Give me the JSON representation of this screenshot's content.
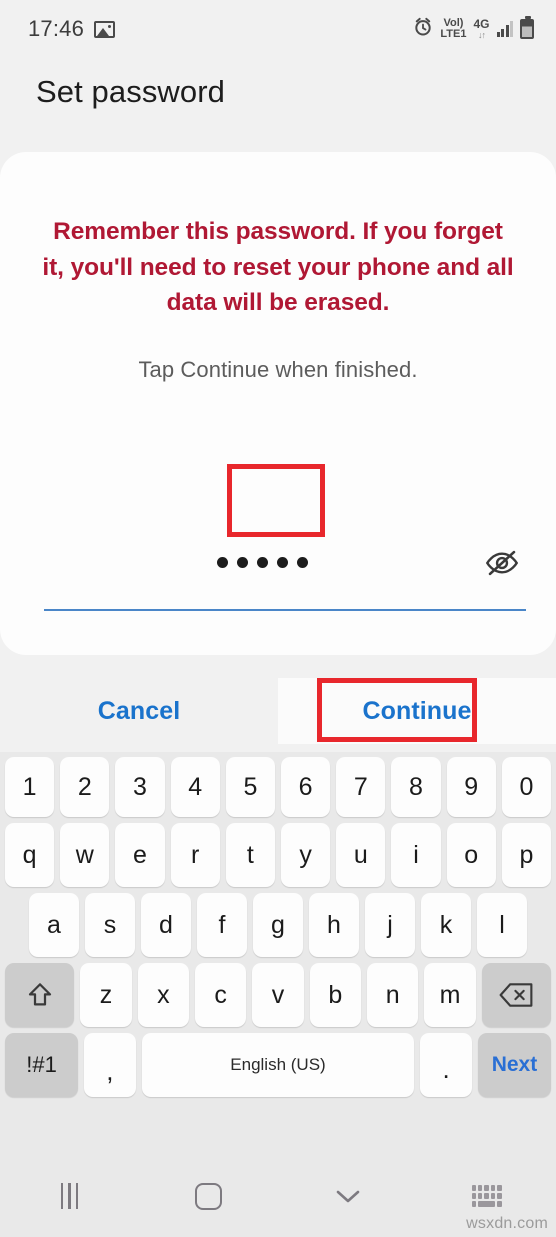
{
  "status_bar": {
    "time": "17:46",
    "icons": [
      "image-thumbnail-icon",
      "alarm-clock-icon",
      "volte-indicator",
      "network-4g",
      "signal-bars-icon",
      "battery-icon"
    ],
    "volte_top": "Vol)",
    "volte_bottom": "LTE1",
    "network": "4G",
    "network_arrows": "↓↑"
  },
  "header": {
    "title": "Set password"
  },
  "card": {
    "warning": "Remember this password. If you forget it, you'll need to reset your phone and all data will be erased.",
    "hint": "Tap Continue when finished.",
    "password_field": {
      "value": "•••••",
      "dot_count": 5,
      "toggle_icon": "eye-off-icon",
      "underline_color": "#4a86c8"
    }
  },
  "actions": {
    "cancel_label": "Cancel",
    "continue_label": "Continue",
    "accent_color": "#1a73cc"
  },
  "annotations": {
    "highlight_color": "#e8272c",
    "targets": [
      "password-field",
      "continue-button"
    ]
  },
  "keyboard": {
    "row_numbers": [
      "1",
      "2",
      "3",
      "4",
      "5",
      "6",
      "7",
      "8",
      "9",
      "0"
    ],
    "row_top": [
      "q",
      "w",
      "e",
      "r",
      "t",
      "y",
      "u",
      "i",
      "o",
      "p"
    ],
    "row_home": [
      "a",
      "s",
      "d",
      "f",
      "g",
      "h",
      "j",
      "k",
      "l"
    ],
    "row_bottom": [
      "z",
      "x",
      "c",
      "v",
      "b",
      "n",
      "m"
    ],
    "shift_key": "shift-icon",
    "backspace_key": "backspace-icon",
    "symbols_label": "!#1",
    "comma_label": ",",
    "space_label": "English (US)",
    "period_label": ".",
    "next_label": "Next"
  },
  "navbar": {
    "recents": "recents-icon",
    "home": "home-icon",
    "dismiss": "chevron-down-icon",
    "keyboard_switch": "keyboard-switch-icon"
  },
  "watermark": "wsxdn.com"
}
